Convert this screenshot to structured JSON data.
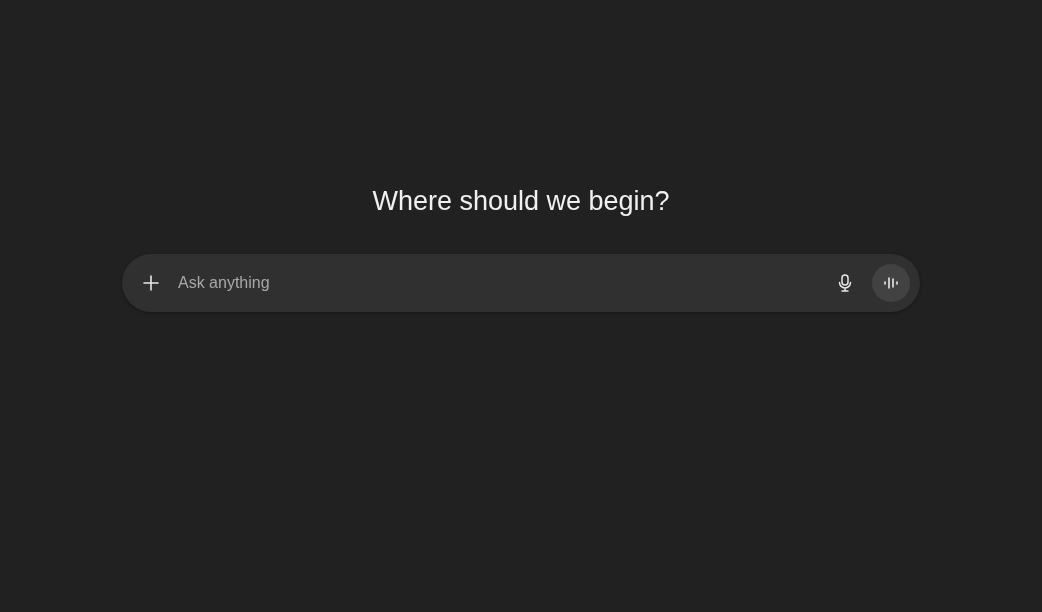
{
  "heading": "Where should we begin?",
  "composer": {
    "placeholder": "Ask anything"
  }
}
